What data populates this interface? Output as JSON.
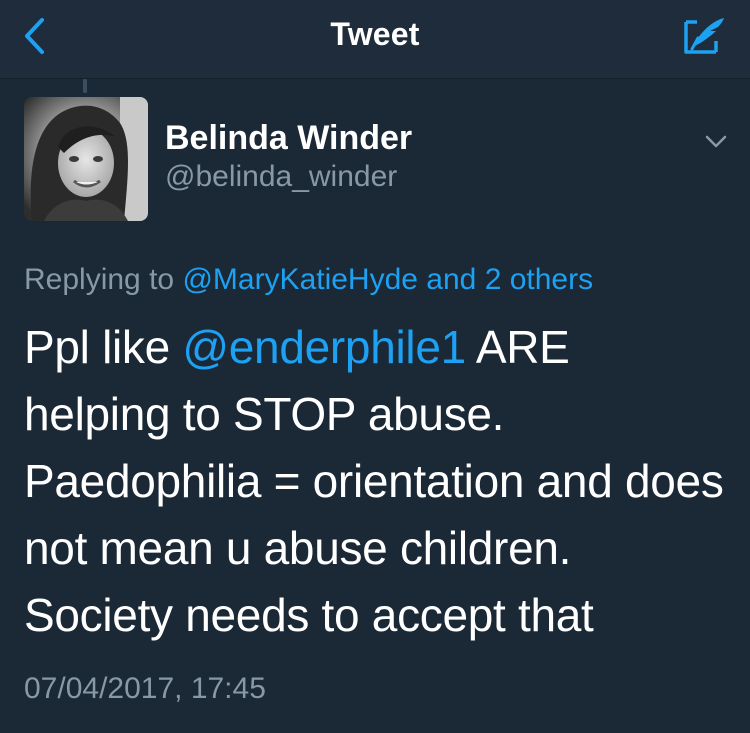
{
  "navbar": {
    "title": "Tweet",
    "back_icon": "chevron-left-icon",
    "compose_icon": "compose-tweet-icon",
    "accent_color": "#1da1f2"
  },
  "author": {
    "name": "Belinda Winder",
    "handle": "@belinda_winder",
    "menu_icon": "chevron-down-icon"
  },
  "reply": {
    "prefix": "Replying to",
    "target": "@MaryKatieHyde and 2 others"
  },
  "tweet": {
    "text_before": "Ppl like ",
    "mention": "@enderphile1",
    "text_after": " ARE helping to STOP abuse. Paedophilia = orientation and does not mean u abuse children. Society needs to accept that",
    "timestamp": "07/04/2017, 17:45"
  },
  "colors": {
    "background": "#1b2836",
    "navbar": "#1f2c3b",
    "primary_text": "#ffffff",
    "secondary_text": "#8899a6",
    "link": "#1da1f2"
  }
}
